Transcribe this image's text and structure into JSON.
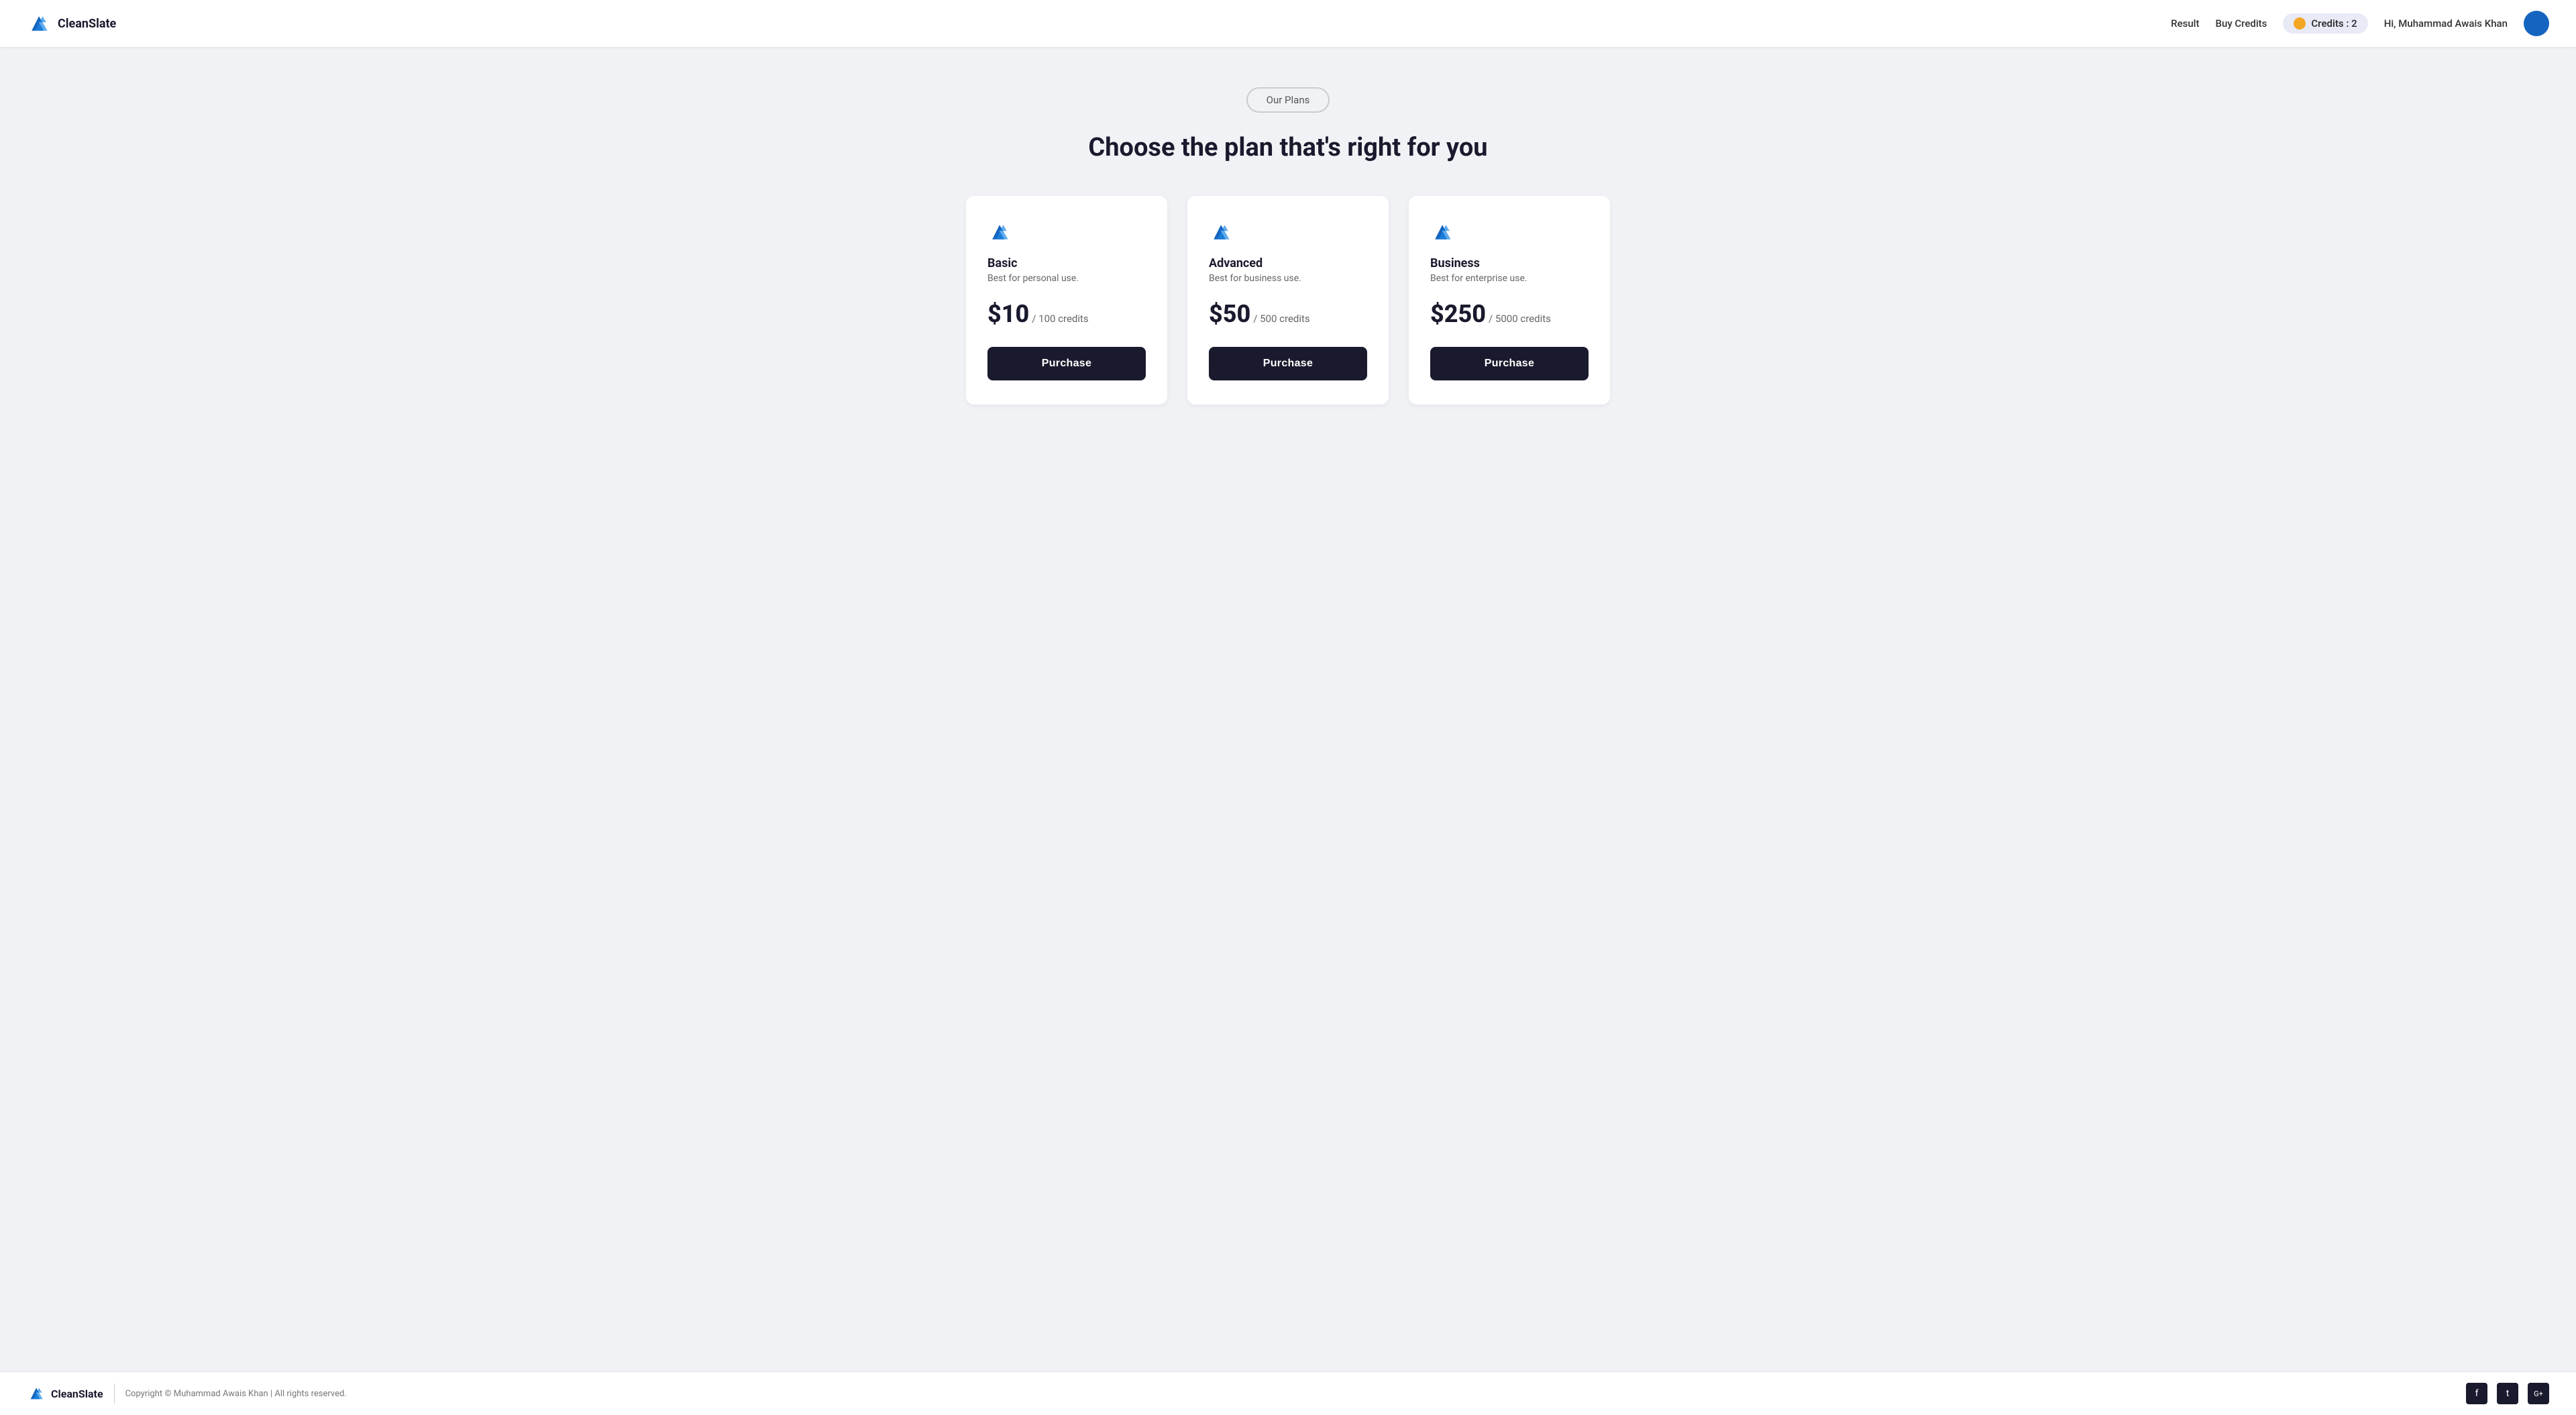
{
  "header": {
    "logo_text": "CleanSlate",
    "nav": {
      "result_label": "Result",
      "buy_credits_label": "Buy Credits"
    },
    "credits": {
      "label": "Credits : 2",
      "count": 2
    },
    "user": {
      "greeting": "Hi, Muhammad Awais Khan"
    }
  },
  "main": {
    "badge_label": "Our Plans",
    "heading": "Choose the plan that's right for you",
    "plans": [
      {
        "name": "Basic",
        "description": "Best for personal use.",
        "price": "$10",
        "price_suffix": "/ 100 credits",
        "button_label": "Purchase"
      },
      {
        "name": "Advanced",
        "description": "Best for business use.",
        "price": "$50",
        "price_suffix": "/ 500 credits",
        "button_label": "Purchase"
      },
      {
        "name": "Business",
        "description": "Best for enterprise use.",
        "price": "$250",
        "price_suffix": "/ 5000 credits",
        "button_label": "Purchase"
      }
    ]
  },
  "footer": {
    "logo_text": "CleanSlate",
    "copyright": "Copyright © Muhammad Awais Khan | All rights reserved.",
    "social": [
      {
        "icon": "f",
        "label": "facebook-icon"
      },
      {
        "icon": "t",
        "label": "twitter-icon"
      },
      {
        "icon": "G+",
        "label": "googleplus-icon"
      }
    ]
  }
}
